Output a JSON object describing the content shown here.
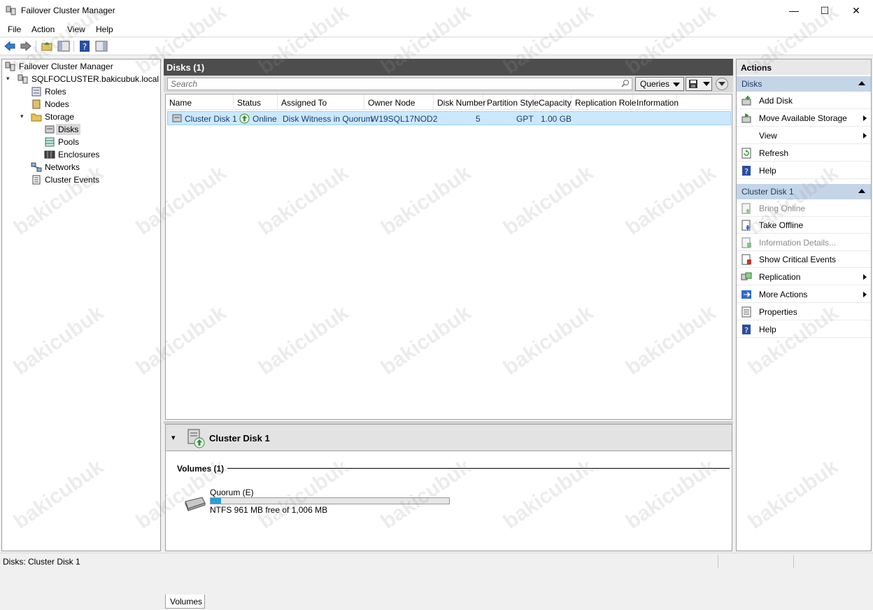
{
  "window": {
    "title": "Failover Cluster Manager",
    "minimize": "—",
    "maximize": "☐",
    "close": "✕"
  },
  "menu": {
    "file": "File",
    "action": "Action",
    "view": "View",
    "help": "Help"
  },
  "tree": {
    "root": "Failover Cluster Manager",
    "cluster": "SQLFOCLUSTER.bakicubuk.local",
    "roles": "Roles",
    "nodes": "Nodes",
    "storage": "Storage",
    "disks": "Disks",
    "pools": "Pools",
    "enclosures": "Enclosures",
    "networks": "Networks",
    "cluster_events": "Cluster Events"
  },
  "center": {
    "header": "Disks (1)",
    "search_placeholder": "Search",
    "queries_label": "Queries",
    "columns": [
      "Name",
      "Status",
      "Assigned To",
      "Owner Node",
      "Disk Number",
      "Partition Style",
      "Capacity",
      "Replication Role",
      "Information"
    ],
    "row": {
      "name": "Cluster Disk 1",
      "status": "Online",
      "assigned_to": "Disk Witness in Quorum",
      "owner_node": "W19SQL17NOD2",
      "disk_number": "5",
      "partition_style": "GPT",
      "capacity": "1.00 GB"
    }
  },
  "detail": {
    "title": "Cluster Disk 1",
    "volumes_header": "Volumes (1)",
    "volume_name": "Quorum (E)",
    "volume_info": "NTFS 961 MB free of 1,006 MB",
    "used_fraction": 0.045,
    "tab_volumes": "Volumes"
  },
  "actions": {
    "title": "Actions",
    "section_disks": "Disks",
    "disks_items": [
      "Add Disk",
      "Move Available Storage",
      "View",
      "Refresh",
      "Help"
    ],
    "section_disk1": "Cluster Disk 1",
    "disk1_items": [
      "Bring Online",
      "Take Offline",
      "Information Details...",
      "Show Critical Events",
      "Replication",
      "More Actions",
      "Properties",
      "Help"
    ]
  },
  "status_bar": {
    "text": "Disks:  Cluster Disk 1"
  },
  "watermark": "bakicubuk",
  "colors": {
    "header_bg": "#4d4d4d",
    "selection": "#cce8ff",
    "action_section": "#c5d5e8",
    "progress": "#26a0da"
  }
}
